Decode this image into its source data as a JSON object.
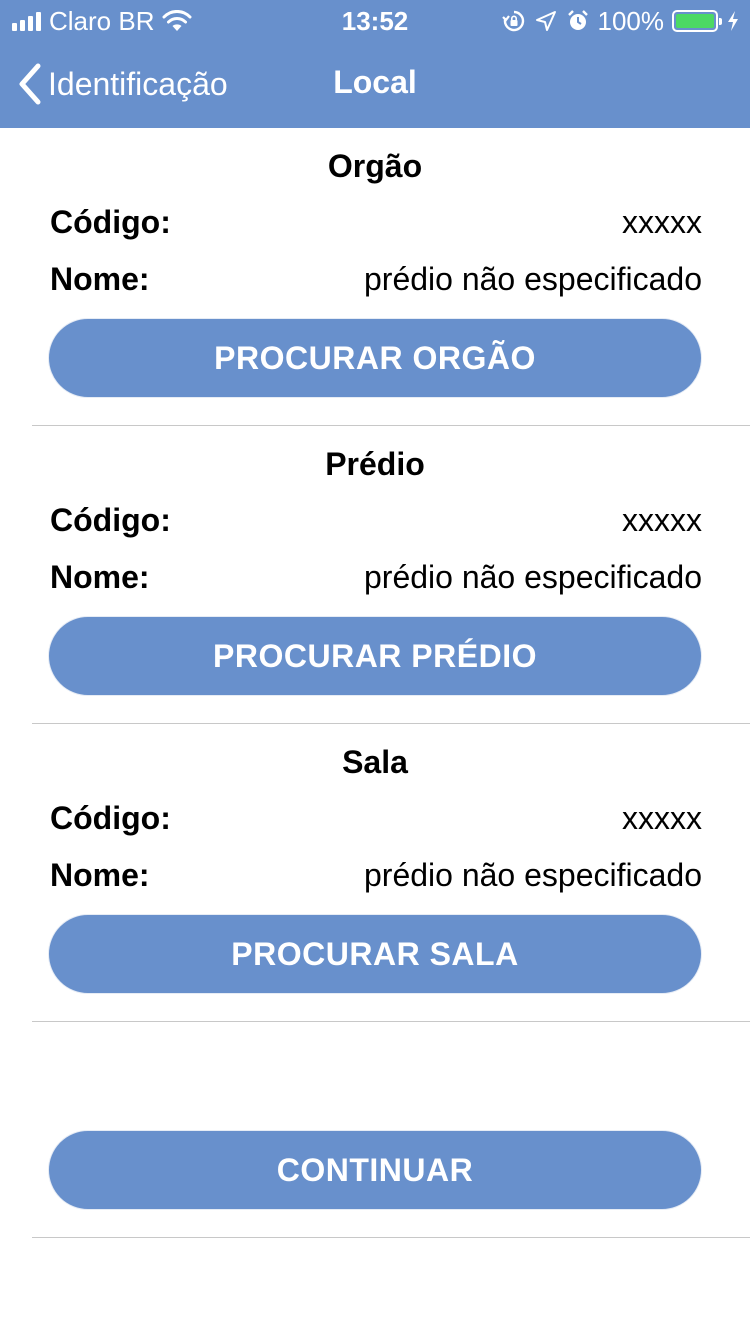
{
  "status_bar": {
    "carrier": "Claro BR",
    "time": "13:52",
    "battery_percent": "100%"
  },
  "nav": {
    "back_label": "Identificação",
    "title": "Local"
  },
  "sections": [
    {
      "title": "Orgão",
      "code_label": "Código:",
      "code_value": "xxxxx",
      "name_label": "Nome:",
      "name_value": "prédio não especificado",
      "button_label": "PROCURAR ORGÃO"
    },
    {
      "title": "Prédio",
      "code_label": "Código:",
      "code_value": "xxxxx",
      "name_label": "Nome:",
      "name_value": "prédio não especificado",
      "button_label": "PROCURAR PRÉDIO"
    },
    {
      "title": "Sala",
      "code_label": "Código:",
      "code_value": "xxxxx",
      "name_label": "Nome:",
      "name_value": "prédio não especificado",
      "button_label": "PROCURAR SALA"
    }
  ],
  "footer": {
    "continue_label": "CONTINUAR"
  },
  "colors": {
    "accent": "#6890cc",
    "battery": "#4cd964",
    "divider": "#c8c8c8"
  }
}
